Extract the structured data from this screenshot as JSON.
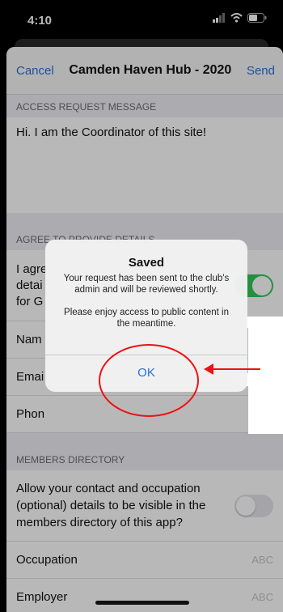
{
  "status_bar": {
    "time": "4:10"
  },
  "navbar": {
    "cancel": "Cancel",
    "title": "Camden Haven Hub - 2020",
    "send": "Send"
  },
  "sections": {
    "access_request": {
      "header": "ACCESS REQUEST MESSAGE",
      "message": "Hi. I am the Coordinator of this site!"
    },
    "agree": {
      "header": "AGREE TO PROVIDE DETAILS",
      "agree_label": "I agre\ndetai\nfor G",
      "name_label": "Nam",
      "email_label": "Emai",
      "phone_label": "Phon"
    },
    "members": {
      "header": "MEMBERS DIRECTORY",
      "allow_text": "Allow your contact and occupation (optional) details to be visible in the members directory of this app?",
      "occupation_label": "Occupation",
      "occupation_placeholder": "ABC",
      "employer_label": "Employer",
      "employer_placeholder": "ABC"
    }
  },
  "alert": {
    "title": "Saved",
    "message1": "Your request has been sent to the club's admin and will be reviewed shortly.",
    "message2": "Please enjoy access to public content in the meantime.",
    "ok": "OK"
  },
  "colors": {
    "accent": "#2b6fd6",
    "toggle_on": "#34c759",
    "annotation": "#e11111"
  }
}
